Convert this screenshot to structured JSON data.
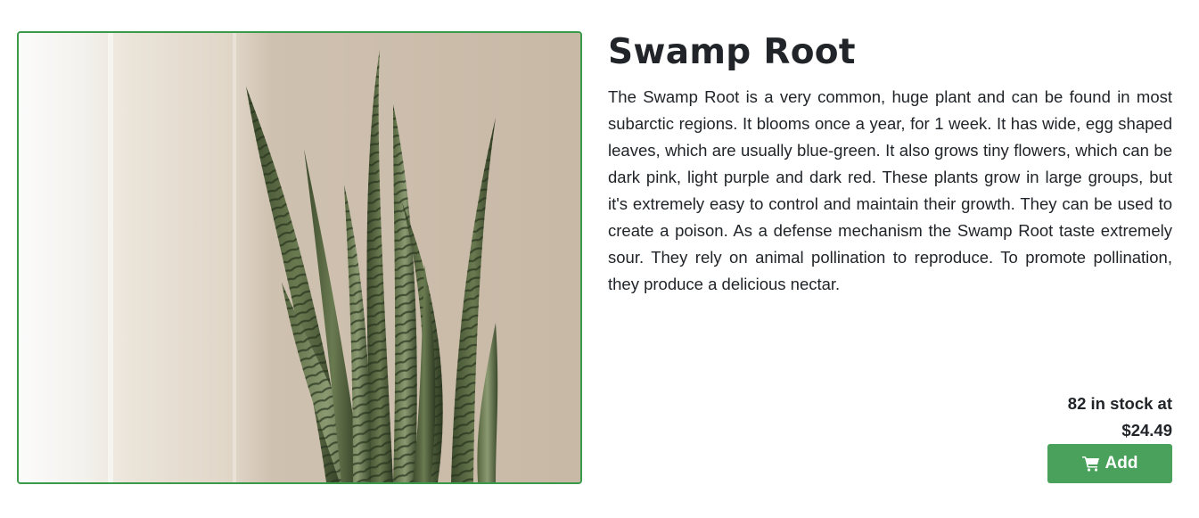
{
  "product": {
    "title": "Swamp Root",
    "description": "The Swamp Root is a very common, huge plant and can be found in most subarctic regions. It blooms once a year, for 1 week. It has wide, egg shaped leaves, which are usually blue-green. It also grows tiny flowers, which can be dark pink, light purple and dark red. These plants grow in large groups, but it's extremely easy to control and maintain their growth. They can be used to create a poison. As a defense mechanism the Swamp Root taste extremely sour. They rely on animal pollination to reproduce. To promote pollination, they produce a delicious nectar.",
    "stock_line": "82 in stock at",
    "price": "$24.49",
    "add_label": "Add",
    "image_subject": "snake-plant-photo",
    "cart_icon": "shopping-cart-icon"
  },
  "colors": {
    "accent": "#4aa15b",
    "image_border": "#3a9a4a",
    "text": "#212529"
  }
}
